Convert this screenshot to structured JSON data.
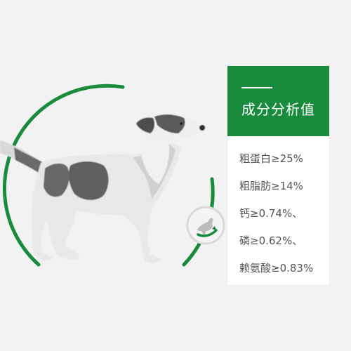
{
  "colors": {
    "accent": "#1a8a3c",
    "background": "#f2f2f2",
    "panel": "#ffffff",
    "text": "#555555"
  },
  "icons": [
    "dog-jumping-icon"
  ],
  "panel": {
    "title": "成分分析值",
    "items": [
      "粗蛋白≥25%",
      "粗脂肪≥14%",
      "钙≥0.74%、",
      "磷≥0.62%、",
      "赖氨酸≥0.83%"
    ]
  }
}
